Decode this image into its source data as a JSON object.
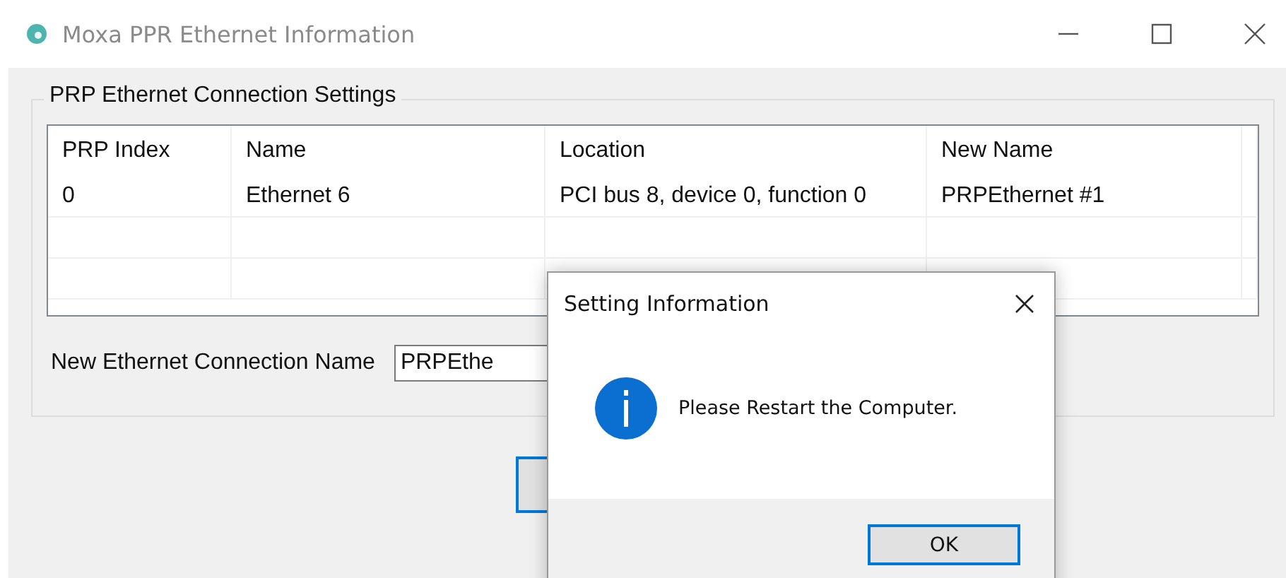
{
  "window": {
    "title": "Moxa PPR Ethernet Information"
  },
  "group": {
    "title": "PRP Ethernet Connection Settings"
  },
  "table": {
    "columns": [
      "PRP Index",
      "Name",
      "Location",
      "New Name"
    ],
    "rows": [
      [
        "0",
        "Ethernet 6",
        "PCI bus 8, device 0, function 0",
        "PRPEthernet #1"
      ]
    ]
  },
  "name_field": {
    "label": "New Ethernet Connection Name",
    "value": "PRPEthe"
  },
  "dialog": {
    "title": "Setting Information",
    "message": "Please Restart the Computer.",
    "button": "OK"
  }
}
